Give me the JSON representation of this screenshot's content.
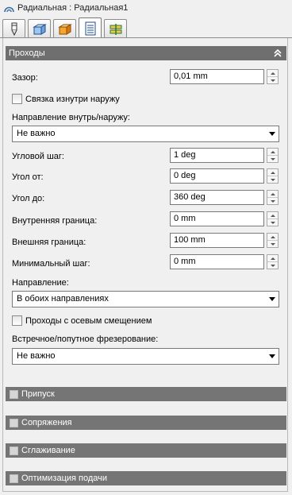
{
  "window": {
    "title": "Радиальная : Радиальная1"
  },
  "tabs": [
    {
      "icon": "tool-icon"
    },
    {
      "icon": "stock-box-icon"
    },
    {
      "icon": "model-box-icon"
    },
    {
      "icon": "toolpath-icon",
      "active": true
    },
    {
      "icon": "levels-icon"
    }
  ],
  "passes": {
    "header": "Проходы",
    "gap_label": "Зазор:",
    "gap_value": "0,01 mm",
    "link_label": "Связка изнутри наружу",
    "direction_inout_label": "Направление внутрь/наружу:",
    "direction_inout_value": "Не важно",
    "angle_step_label": "Угловой шаг:",
    "angle_step_value": "1 deg",
    "angle_from_label": "Угол от:",
    "angle_from_value": "0 deg",
    "angle_to_label": "Угол до:",
    "angle_to_value": "360 deg",
    "inner_bound_label": "Внутренняя граница:",
    "inner_bound_value": "0 mm",
    "outer_bound_label": "Внешняя граница:",
    "outer_bound_value": "100 mm",
    "min_step_label": "Минимальный шаг:",
    "min_step_value": "0 mm",
    "direction_label": "Направление:",
    "direction_value": "В обоих направлениях",
    "axial_offset_label": "Проходы с осевым смещением",
    "milling_label": "Встречное/попутное фрезерование:",
    "milling_value": "Не важно"
  },
  "sections": {
    "allowance": "Припуск",
    "linking": "Сопряжения",
    "smoothing": "Сглаживание",
    "feed_optimization": "Оптимизация подачи"
  }
}
